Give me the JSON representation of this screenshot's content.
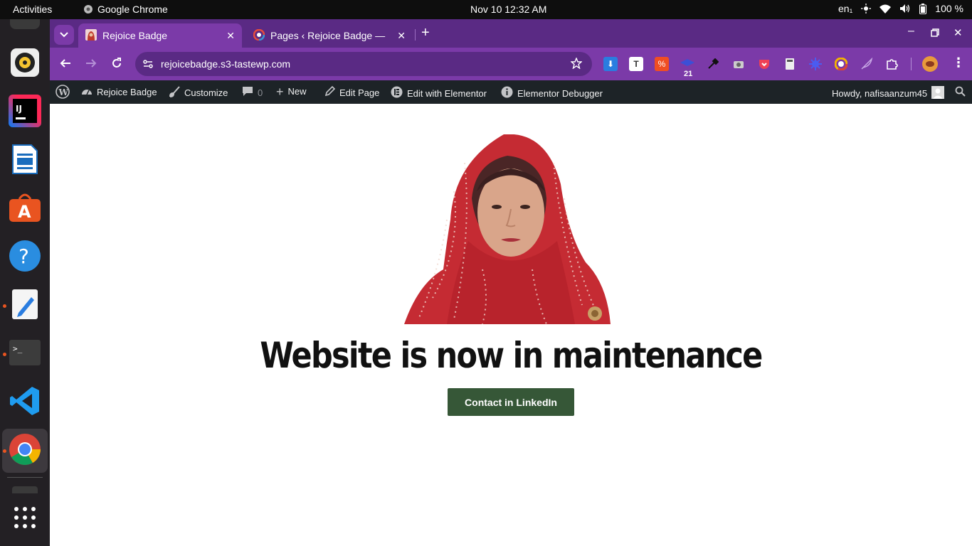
{
  "system": {
    "activities": "Activities",
    "app_name": "Google Chrome",
    "clock": "Nov 10  12:32 AM",
    "lang": "en₁",
    "battery": "100 %"
  },
  "tabs": [
    {
      "label": "Rejoice Badge"
    },
    {
      "label": "Pages ‹ Rejoice Badge —"
    }
  ],
  "address": {
    "url": "rejoicebadge.s3-tastewp.com"
  },
  "extensions": {
    "badge_count": "21"
  },
  "admin_bar": {
    "site": "Rejoice Badge",
    "customize": "Customize",
    "comments": "0",
    "new": "New",
    "edit_page": "Edit Page",
    "edit_elementor": "Edit with Elementor",
    "debugger": "Elementor Debugger",
    "howdy": "Howdy, nafisaanzum45"
  },
  "main": {
    "headline": "Website is now in maintenance",
    "cta": "Contact in LinkedIn"
  },
  "colors": {
    "tabstrip": "#5a2a84",
    "toolbar": "#7b3aa8",
    "admin_bar": "#1d2327",
    "cta": "#365737"
  }
}
